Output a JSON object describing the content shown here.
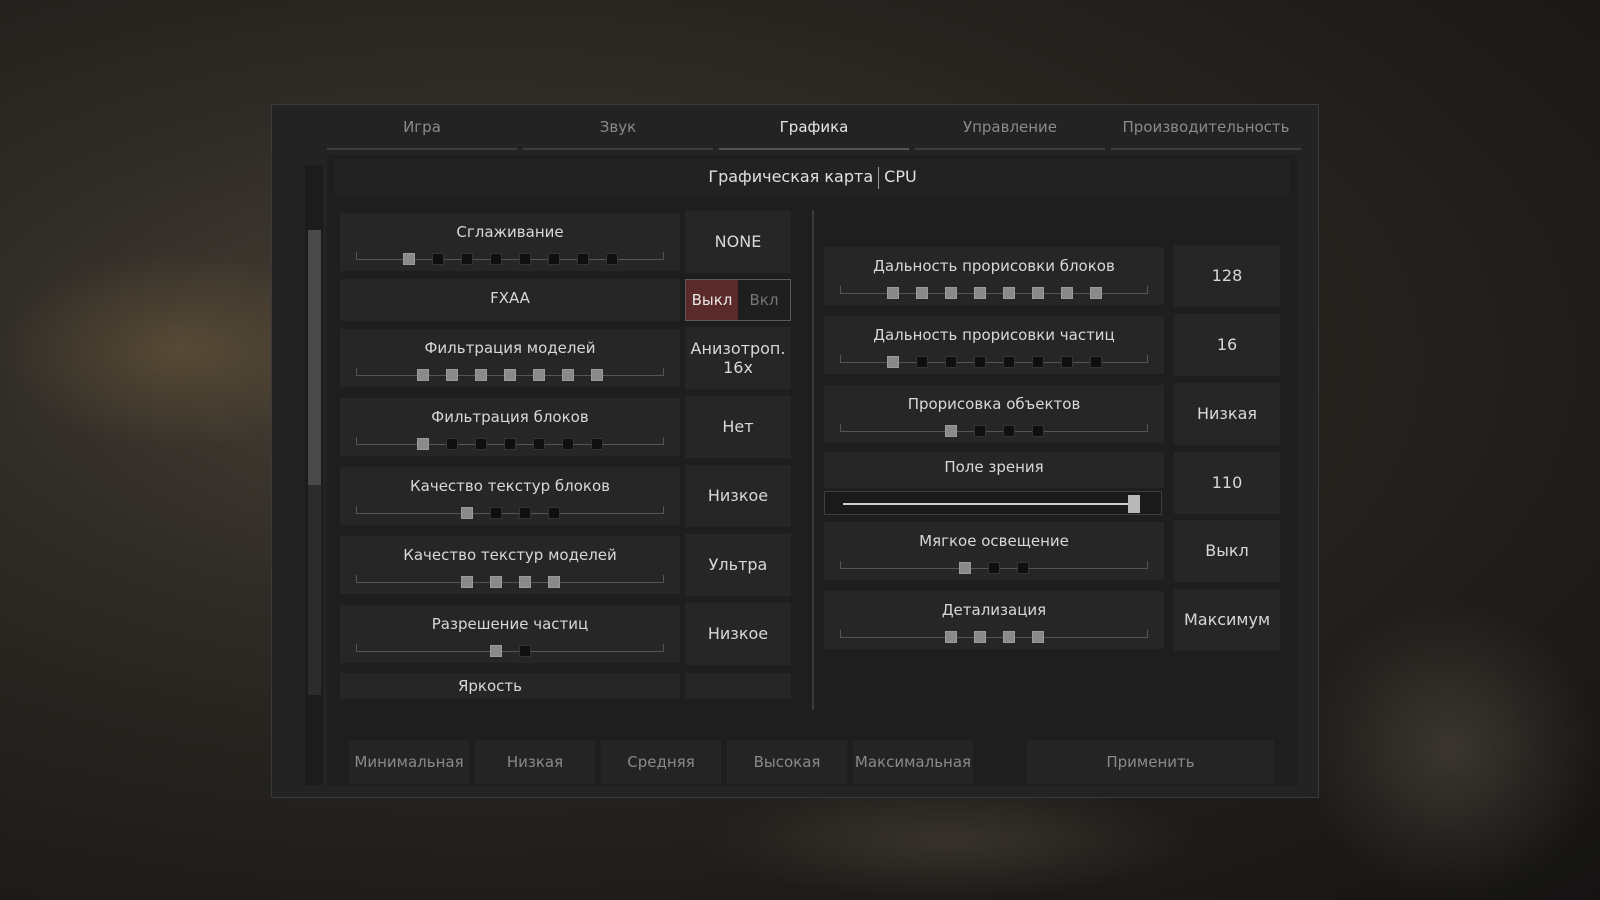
{
  "tabs": [
    {
      "label": "Игра",
      "active": false
    },
    {
      "label": "Звук",
      "active": false
    },
    {
      "label": "Графика",
      "active": true
    },
    {
      "label": "Управление",
      "active": false
    },
    {
      "label": "Производительность",
      "active": false
    }
  ],
  "subheader": {
    "left": "Графическая карта",
    "right": "CPU"
  },
  "left": {
    "antialiasing": {
      "label": "Сглаживание",
      "value": "NONE",
      "steps": 8,
      "level": 1
    },
    "fxaa": {
      "label": "FXAA",
      "off": "Выкл",
      "on": "Вкл",
      "selected": "off"
    },
    "model_filter": {
      "label": "Фильтрация моделей",
      "value": "Анизотроп. 16x",
      "steps": 7,
      "level": 7
    },
    "block_filter": {
      "label": "Фильтрация блоков",
      "value": "Нет",
      "steps": 7,
      "level": 1
    },
    "block_textures": {
      "label": "Качество текстур блоков",
      "value": "Низкое",
      "steps": 4,
      "level": 1
    },
    "model_textures": {
      "label": "Качество текстур моделей",
      "value": "Ультра",
      "steps": 4,
      "level": 4
    },
    "particle_res": {
      "label": "Разрешение частиц",
      "value": "Низкое",
      "steps": 2,
      "level": 1
    },
    "brightness": {
      "label": "Яркость"
    }
  },
  "right": {
    "block_distance": {
      "label": "Дальность прорисовки блоков",
      "value": "128",
      "steps": 8,
      "level": 8
    },
    "particle_distance": {
      "label": "Дальность прорисовки частиц",
      "value": "16",
      "steps": 8,
      "level": 1
    },
    "object_render": {
      "label": "Прорисовка объектов",
      "value": "Низкая",
      "steps": 4,
      "level": 1
    },
    "fov": {
      "label": "Поле зрения",
      "value": "110",
      "fraction": 0.97
    },
    "soft_light": {
      "label": "Мягкое освещение",
      "value": "Выкл",
      "steps": 3,
      "level": 1
    },
    "detail": {
      "label": "Детализация",
      "value": "Максимум",
      "steps": 4,
      "level": 4
    }
  },
  "presets": [
    "Минимальная",
    "Низкая",
    "Средняя",
    "Высокая",
    "Максимальная"
  ],
  "apply_label": "Применить"
}
